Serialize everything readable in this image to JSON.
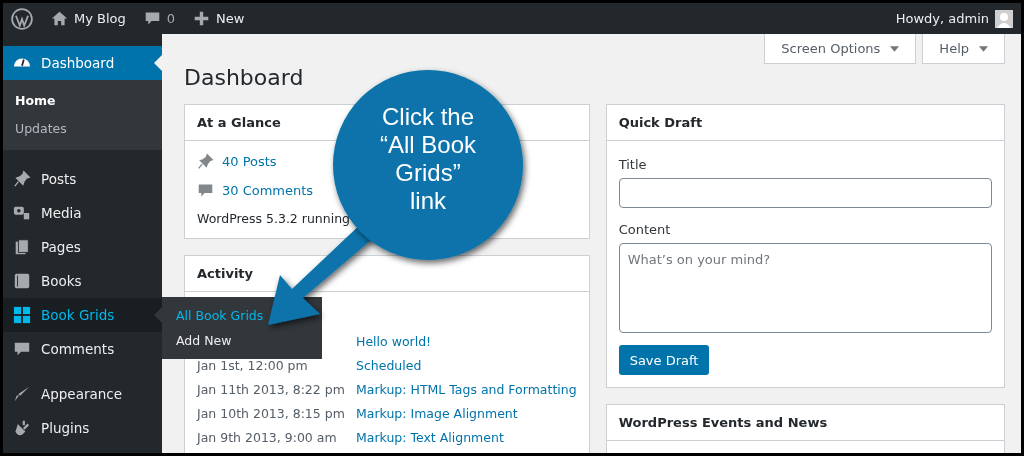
{
  "admin_bar": {
    "site_name": "My Blog",
    "comments_count": "0",
    "new_label": "New",
    "greeting": "Howdy, admin"
  },
  "sidebar": {
    "items": [
      {
        "label": "Dashboard",
        "selected": true,
        "children": [
          {
            "label": "Home",
            "selected": true
          },
          {
            "label": "Updates",
            "selected": false
          }
        ]
      },
      {
        "label": "Posts",
        "selected": false
      },
      {
        "label": "Media",
        "selected": false
      },
      {
        "label": "Pages",
        "selected": false
      },
      {
        "label": "Books",
        "selected": false
      },
      {
        "label": "Book Grids",
        "selected": false,
        "hovered": true,
        "flyout": [
          {
            "label": "All Book Grids",
            "selected": true
          },
          {
            "label": "Add New",
            "selected": false
          }
        ]
      },
      {
        "label": "Comments",
        "selected": false
      },
      {
        "label": "Appearance",
        "selected": false
      },
      {
        "label": "Plugins",
        "selected": false
      }
    ]
  },
  "screen_tabs": [
    "Screen Options",
    "Help"
  ],
  "page_title": "Dashboard",
  "at_a_glance": {
    "title": "At a Glance",
    "posts": "40 Posts",
    "comments": "30 Comments",
    "version_note": "WordPress 5.3.2 running"
  },
  "activity": {
    "title": "Activity",
    "rows": [
      {
        "post": "Hello world!"
      },
      {
        "date": "Jan 1st, 12:00 pm",
        "post": "Scheduled"
      },
      {
        "date": "Jan 11th 2013, 8:22 pm",
        "post": "Markup: HTML Tags and Formatting"
      },
      {
        "date": "Jan 10th 2013, 8:15 pm",
        "post": "Markup: Image Alignment"
      },
      {
        "date": "Jan 9th 2013, 9:00 am",
        "post": "Markup: Text Alignment"
      }
    ]
  },
  "quick_draft": {
    "title": "Quick Draft",
    "title_label": "Title",
    "content_label": "Content",
    "content_placeholder": "What’s on your mind?",
    "button": "Save Draft"
  },
  "events": {
    "title": "WordPress Events and News"
  },
  "callout": {
    "text": "Click the “All Book Grids” link"
  }
}
